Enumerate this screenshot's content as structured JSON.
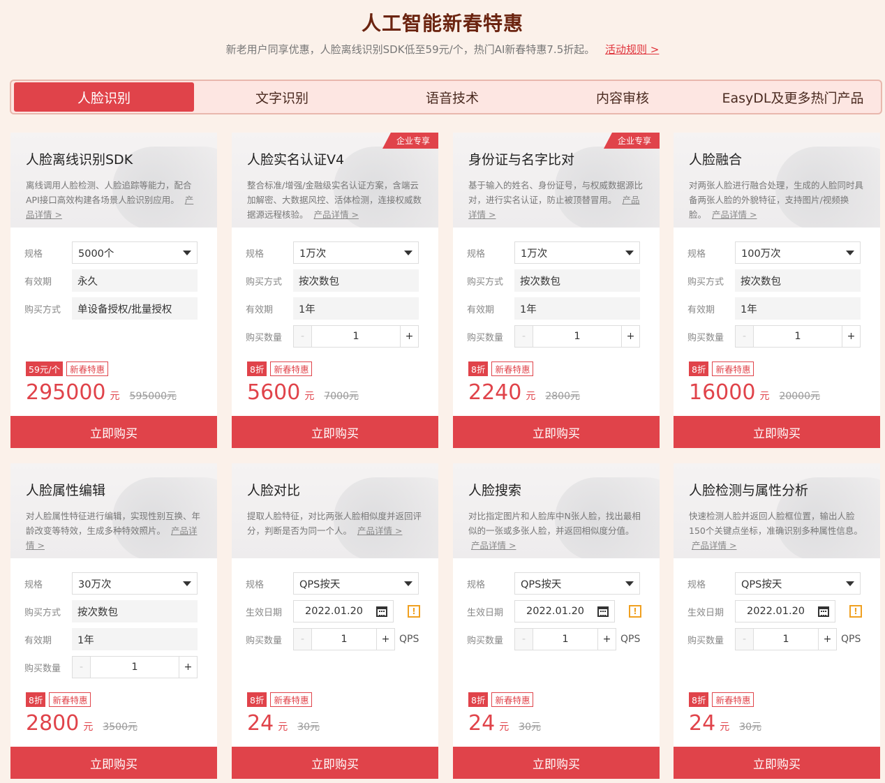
{
  "header": {
    "title": "人工智能新春特惠",
    "subtitle": "新老用户同享优惠，人脸离线识别SDK低至59元/个，热门AI新春特惠7.5折起。",
    "rules_link": "活动规则 >"
  },
  "tabs": [
    "人脸识别",
    "文字识别",
    "语音技术",
    "内容审核",
    "EasyDL及更多热门产品"
  ],
  "colors": {
    "accent": "#e0434a",
    "title": "#6b2410",
    "background": "#fbf1ea"
  },
  "labels": {
    "spec": "规格",
    "validity": "有效期",
    "purchase_mode": "购买方式",
    "quantity": "购买数量",
    "effective_date": "生效日期",
    "detail": "产品详情 >",
    "buy": "立即购买",
    "yuan": "元",
    "promo": "新春特惠",
    "corp": "企业专享",
    "qps": "QPS",
    "minus": "-",
    "plus": "+"
  },
  "cards": [
    {
      "title": "人脸离线识别SDK",
      "desc": "离线调用人脸检测、人脸追踪等能力，配合API接口高效构建各场景人脸识别应用。",
      "spec": "5000个",
      "validity": "永久",
      "mode": "单设备授权/批量授权",
      "discount": "59元/个",
      "price": "295000",
      "orig": "595000元"
    },
    {
      "title": "人脸实名认证V4",
      "desc": "整合标准/增强/金融级实名认证方案，含端云加解密、大数据风控、活体检测，连接权威数据源远程核验。",
      "spec": "1万次",
      "mode": "按次数包",
      "validity": "1年",
      "qty": "1",
      "discount": "8折",
      "price": "5600",
      "orig": "7000元"
    },
    {
      "title": "身份证与名字比对",
      "desc": "基于输入的姓名、身份证号，与权威数据源比对，进行实名认证，防止被顶替冒用。",
      "spec": "1万次",
      "mode": "按次数包",
      "validity": "1年",
      "qty": "1",
      "discount": "8折",
      "price": "2240",
      "orig": "2800元"
    },
    {
      "title": "人脸融合",
      "desc": "对两张人脸进行融合处理，生成的人脸同时具备两张人脸的外貌特征，支持图片/视频换脸。",
      "spec": "100万次",
      "mode": "按次数包",
      "validity": "1年",
      "qty": "1",
      "discount": "8折",
      "price": "16000",
      "orig": "20000元"
    },
    {
      "title": "人脸属性编辑",
      "desc": "对人脸属性特征进行编辑，实现性别互换、年龄改变等特效，生成多种特效照片。",
      "spec": "30万次",
      "mode": "按次数包",
      "validity": "1年",
      "qty": "1",
      "discount": "8折",
      "price": "2800",
      "orig": "3500元"
    },
    {
      "title": "人脸对比",
      "desc": "提取人脸特征，对比两张人脸相似度并返回评分，判断是否为同一个人。",
      "spec": "QPS按天",
      "date": "2022.01.20",
      "qty": "1",
      "discount": "8折",
      "price": "24",
      "orig": "30元"
    },
    {
      "title": "人脸搜索",
      "desc": "对比指定图片和人脸库中N张人脸，找出最相似的一张或多张人脸，并返回相似度分值。",
      "spec": "QPS按天",
      "date": "2022.01.20",
      "qty": "1",
      "discount": "8折",
      "price": "24",
      "orig": "30元"
    },
    {
      "title": "人脸检测与属性分析",
      "desc": "快速检测人脸并返回人脸框位置，输出人脸150个关键点坐标，准确识别多种属性信息。",
      "spec": "QPS按天",
      "date": "2022.01.20",
      "qty": "1",
      "discount": "8折",
      "price": "24",
      "orig": "30元"
    }
  ]
}
